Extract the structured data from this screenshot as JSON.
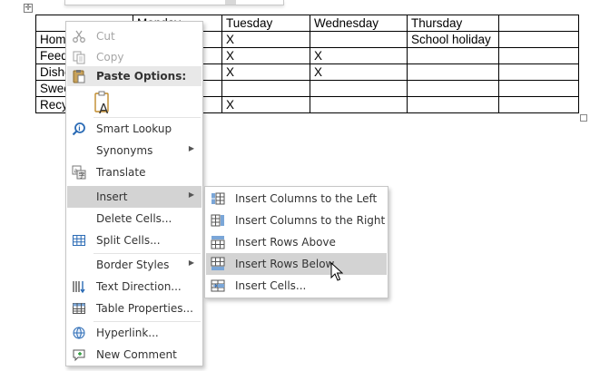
{
  "table": {
    "rows": [
      [
        "",
        "Monday",
        "Tuesday",
        "Wednesday",
        "Thursday",
        ""
      ],
      [
        "Homework",
        "",
        "X",
        "",
        "School holiday",
        ""
      ],
      [
        "Feed the pets",
        "",
        "X",
        "X",
        "",
        ""
      ],
      [
        "Dishes",
        "",
        "X",
        "X",
        "",
        ""
      ],
      [
        "Sweep",
        "",
        "",
        "",
        "",
        ""
      ],
      [
        "Recycling",
        "",
        "X",
        "",
        "",
        ""
      ]
    ]
  },
  "context_menu": {
    "cut": "Cut",
    "copy": "Copy",
    "paste_options": "Paste Options:",
    "smart_lookup": "Smart Lookup",
    "synonyms": "Synonyms",
    "translate": "Translate",
    "insert": "Insert",
    "delete_cells": "Delete Cells...",
    "split_cells": "Split Cells...",
    "border_styles": "Border Styles",
    "text_direction": "Text Direction...",
    "table_properties": "Table Properties...",
    "hyperlink": "Hyperlink...",
    "new_comment": "New Comment"
  },
  "insert_submenu": {
    "items": [
      "Insert Columns to the Left",
      "Insert Columns to the Right",
      "Insert Rows Above",
      "Insert Rows Below",
      "Insert Cells..."
    ],
    "highlighted": "Insert Rows Below"
  },
  "icons": {
    "cut": "scissors-icon",
    "copy": "copy-icon",
    "paste": "clipboard-icon",
    "smart_lookup": "search-icon",
    "translate": "translate-icon",
    "split_cells": "grid-icon",
    "text_direction": "text-direction-icon",
    "table_properties": "table-icon",
    "hyperlink": "link-icon",
    "new_comment": "comment-icon"
  },
  "colors": {
    "menu_highlight": "#d3d3d3",
    "icon_blue": "#2b6bb5",
    "disabled_text": "#a6a6a6"
  }
}
